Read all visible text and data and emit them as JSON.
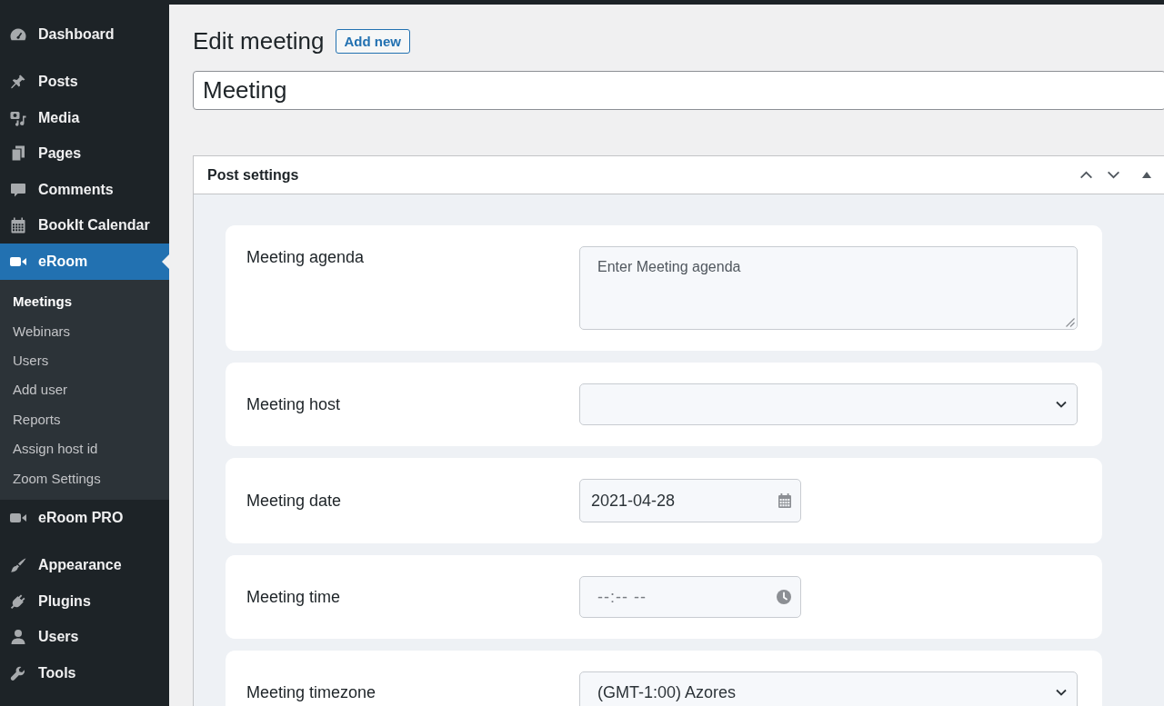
{
  "sidebar": {
    "sections": [
      {
        "items": [
          {
            "label": "Dashboard",
            "selected": false
          }
        ]
      },
      {
        "items": [
          {
            "label": "Posts",
            "selected": false
          },
          {
            "label": "Media",
            "selected": false
          },
          {
            "label": "Pages",
            "selected": false
          },
          {
            "label": "Comments",
            "selected": false
          },
          {
            "label": "BookIt Calendar",
            "selected": false
          },
          {
            "label": "eRoom",
            "selected": true,
            "children": [
              {
                "label": "Meetings",
                "selected": true
              },
              {
                "label": "Webinars",
                "selected": false
              },
              {
                "label": "Users",
                "selected": false
              },
              {
                "label": "Add user",
                "selected": false
              },
              {
                "label": "Reports",
                "selected": false
              },
              {
                "label": "Assign host id",
                "selected": false
              },
              {
                "label": "Zoom Settings",
                "selected": false
              }
            ]
          },
          {
            "label": "eRoom PRO",
            "selected": false
          }
        ]
      },
      {
        "items": [
          {
            "label": "Appearance",
            "selected": false
          },
          {
            "label": "Plugins",
            "selected": false
          },
          {
            "label": "Users",
            "selected": false
          },
          {
            "label": "Tools",
            "selected": false
          }
        ]
      }
    ]
  },
  "header": {
    "title": "Edit meeting",
    "add_button": "Add new"
  },
  "title_field": {
    "value": "Meeting"
  },
  "post_settings": {
    "title": "Post settings",
    "expanded": true,
    "fields": [
      {
        "kind": "textarea",
        "label": "Meeting agenda",
        "placeholder": "Enter Meeting agenda"
      },
      {
        "kind": "select",
        "label": "Meeting host"
      },
      {
        "kind": "date",
        "label": "Meeting date",
        "value": "2021-04-28"
      },
      {
        "kind": "time",
        "label": "Meeting time",
        "placeholder": "--:-- --"
      },
      {
        "kind": "select",
        "label": "Meeting timezone",
        "value": "(GMT-1:00) Azores"
      }
    ]
  }
}
